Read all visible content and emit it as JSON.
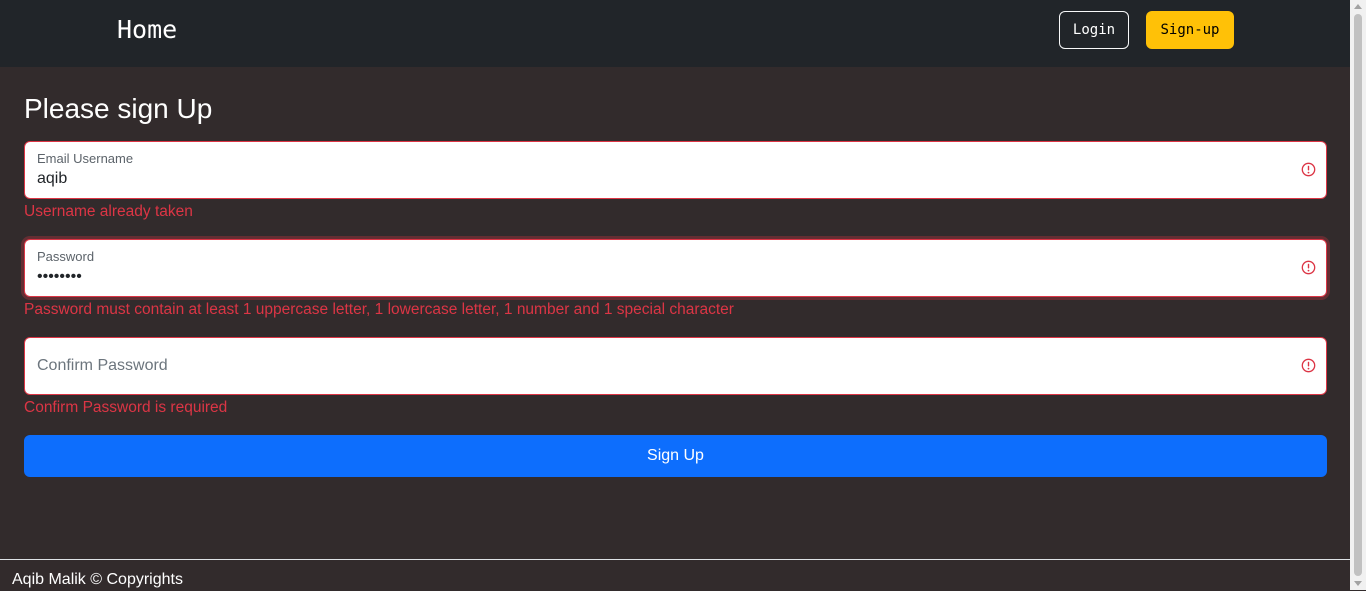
{
  "navbar": {
    "brand": "Home",
    "login_label": "Login",
    "signup_label": "Sign-up"
  },
  "form": {
    "heading": "Please sign Up",
    "email": {
      "label": "Email Username",
      "value": "aqib",
      "error": "Username already taken"
    },
    "password": {
      "label": "Password",
      "value": "••••••••",
      "error": "Password must contain at least 1 uppercase letter, 1 lowercase letter, 1 number and 1 special character"
    },
    "confirm_password": {
      "placeholder": "Confirm Password",
      "error": "Confirm Password is required"
    },
    "submit_label": "Sign Up"
  },
  "footer": {
    "text": "Aqib Malik © Copyrights"
  },
  "colors": {
    "navbar": "#212529",
    "page_background": "#322b2c",
    "error": "#dc3545",
    "primary": "#0d6efd",
    "warning": "#ffc107"
  },
  "icons": {
    "field_status": "exclamation-circle-icon"
  }
}
